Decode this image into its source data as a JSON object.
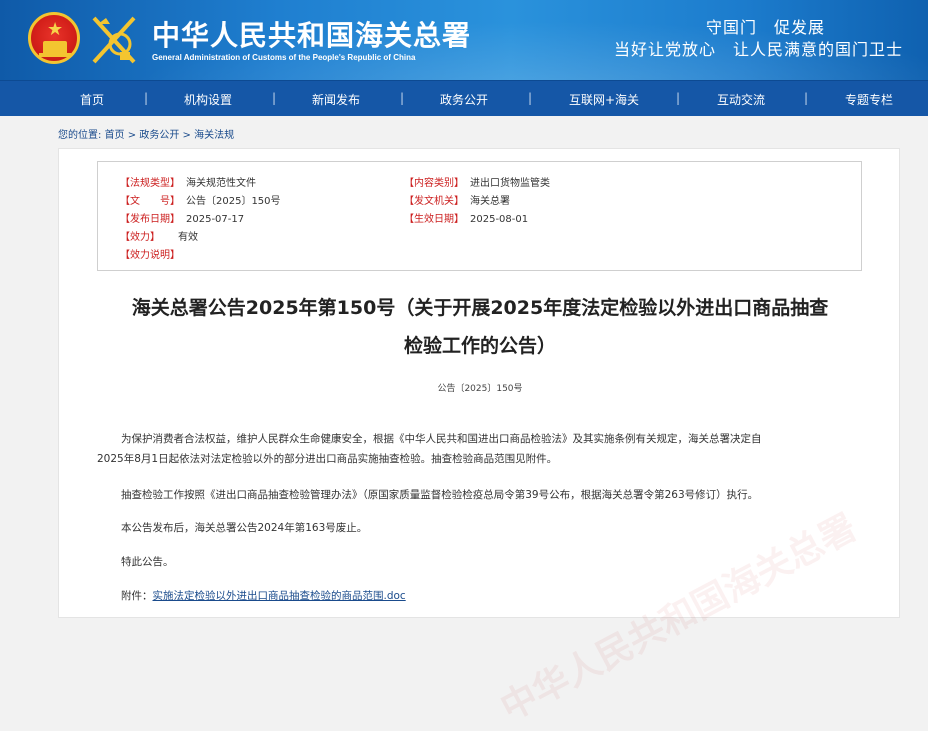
{
  "header": {
    "site_title": "中华人民共和国海关总署",
    "site_subtitle": "General Administration of Customs of the People's Republic of China",
    "slogan_line1": "守国门　促发展",
    "slogan_line2": "当好让党放心　让人民满意的国门卫士"
  },
  "nav": {
    "items": [
      "首页",
      "机构设置",
      "新闻发布",
      "政务公开",
      "互联网+海关",
      "互动交流",
      "专题专栏"
    ]
  },
  "breadcrumb": {
    "prefix": "您的位置:",
    "items": [
      "首页",
      "政务公开",
      "海关法规"
    ],
    "separator": ">"
  },
  "meta": {
    "type_label": "【法规类型】",
    "type_value": "海关规范性文件",
    "category_label": "【内容类别】",
    "category_value": "进出口货物监管类",
    "number_label": "【文　　号】",
    "number_value": "公告〔2025〕150号",
    "issuer_label": "【发文机关】",
    "issuer_value": "海关总署",
    "issue_date_label": "【发布日期】",
    "issue_date_value": "2025-07-17",
    "effective_date_label": "【生效日期】",
    "effective_date_value": "2025-08-01",
    "validity_label": "【效力】",
    "validity_value": "有效",
    "validity_note_label": "【效力说明】"
  },
  "document": {
    "title_line1": "海关总署公告2025年第150号（关于开展2025年度法定检验以外进出口商品抽查",
    "title_line2": "检验工作的公告）",
    "number": "公告〔2025〕150号",
    "para1_line1": "为保护消费者合法权益，维护人民群众生命健康安全，根据《中华人民共和国进出口商品检验法》及其实施条例有关规定，海关总署决定自",
    "para1_line2": "2025年8月1日起依法对法定检验以外的部分进出口商品实施抽查检验。抽查检验商品范围见附件。",
    "para2": "抽查检验工作按照《进出口商品抽查检验管理办法》（原国家质量监督检验检疫总局令第39号公布，根据海关总署令第263号修订）执行。",
    "para3": "本公告发布后，海关总署公告2024年第163号废止。",
    "para4": "特此公告。",
    "attachment_label": "附件：",
    "attachment_link": "实施法定检验以外进出口商品抽查检验的商品范围.doc"
  },
  "watermark": "中华人民共和国海关总署",
  "colors": {
    "header_blue": "#1f7fd0",
    "nav_blue": "#1557a7",
    "label_red": "#cc1f1f",
    "link_blue": "#1a4b8c"
  }
}
